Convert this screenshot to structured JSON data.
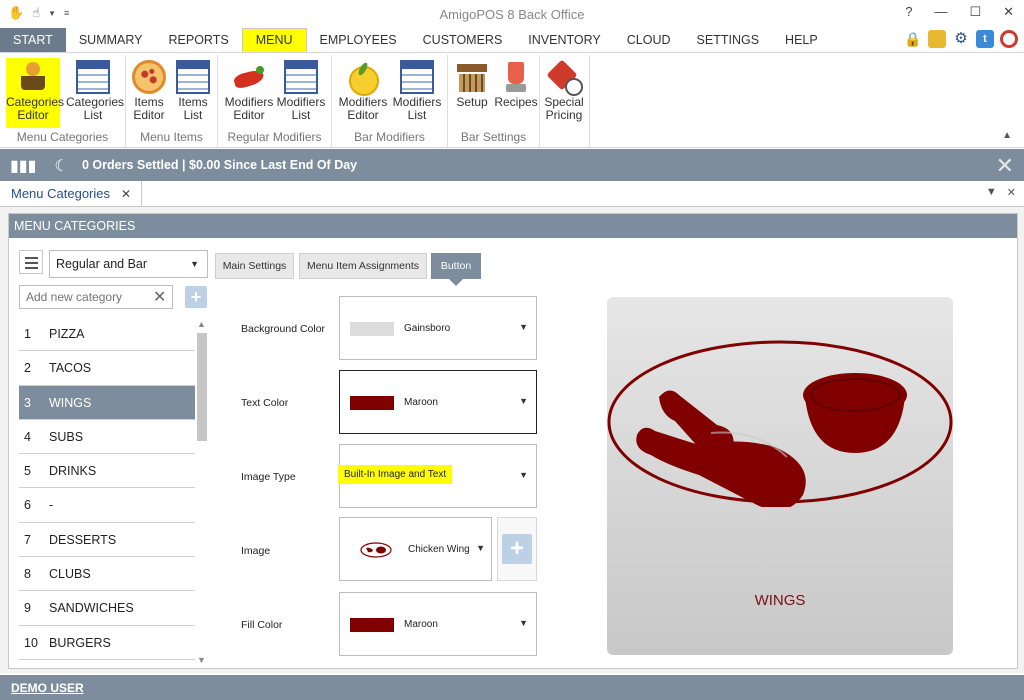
{
  "window": {
    "title": "AmigoPOS 8 Back Office",
    "help": "?"
  },
  "menu_tabs": [
    "START",
    "SUMMARY",
    "REPORTS",
    "MENU",
    "EMPLOYEES",
    "CUSTOMERS",
    "INVENTORY",
    "CLOUD",
    "SETTINGS",
    "HELP"
  ],
  "active_tab": "MENU",
  "ribbon": {
    "groups": [
      {
        "label": "Menu Categories",
        "buttons": [
          {
            "line1": "Categories",
            "line2": "Editor",
            "icon": "categories-editor-icon"
          },
          {
            "line1": "Categories",
            "line2": "List",
            "icon": "table-icon"
          }
        ]
      },
      {
        "label": "Menu Items",
        "buttons": [
          {
            "line1": "Items",
            "line2": "Editor",
            "icon": "pizza-icon"
          },
          {
            "line1": "Items",
            "line2": "List",
            "icon": "table-icon"
          }
        ]
      },
      {
        "label": "Regular Modifiers",
        "buttons": [
          {
            "line1": "Modifiers",
            "line2": "Editor",
            "icon": "pepper-icon"
          },
          {
            "line1": "Modifiers",
            "line2": "List",
            "icon": "table-icon"
          }
        ]
      },
      {
        "label": "Bar Modifiers",
        "buttons": [
          {
            "line1": "Modifiers",
            "line2": "Editor",
            "icon": "lemon-icon"
          },
          {
            "line1": "Modifiers",
            "line2": "List",
            "icon": "table-icon"
          }
        ]
      },
      {
        "label": "Bar Settings",
        "buttons": [
          {
            "line1": "Setup",
            "line2": "",
            "icon": "bar-icon"
          },
          {
            "line1": "Recipes",
            "line2": "",
            "icon": "blender-icon"
          }
        ]
      },
      {
        "label": "",
        "buttons": [
          {
            "line1": "Special",
            "line2": "Pricing",
            "icon": "price-tag-icon"
          }
        ]
      }
    ]
  },
  "status": {
    "text": "0 Orders Settled | $0.00 Since Last End Of Day"
  },
  "doc_tab": {
    "label": "Menu Categories"
  },
  "panel": {
    "title": "MENU CATEGORIES",
    "category_type": "Regular and Bar",
    "add_placeholder": "Add new category",
    "categories": [
      {
        "num": "1",
        "name": "PIZZA"
      },
      {
        "num": "2",
        "name": "TACOS"
      },
      {
        "num": "3",
        "name": "WINGS"
      },
      {
        "num": "4",
        "name": "SUBS"
      },
      {
        "num": "5",
        "name": "DRINKS"
      },
      {
        "num": "6",
        "name": "-"
      },
      {
        "num": "7",
        "name": "DESSERTS"
      },
      {
        "num": "8",
        "name": "CLUBS"
      },
      {
        "num": "9",
        "name": "SANDWICHES"
      },
      {
        "num": "10",
        "name": "BURGERS"
      }
    ],
    "selected_index": 2,
    "settings_tabs": [
      "Main Settings",
      "Menu Item Assignments",
      "Button"
    ],
    "active_settings_tab": "Button",
    "fields": {
      "background_color": {
        "label": "Background Color",
        "value": "Gainsboro",
        "swatch": "#dcdcdc"
      },
      "text_color": {
        "label": "Text Color",
        "value": "Maroon",
        "swatch": "#800000"
      },
      "image_type": {
        "label": "Image Type",
        "value": "Built-In Image and Text"
      },
      "image": {
        "label": "Image",
        "value": "Chicken Wing"
      },
      "fill_color": {
        "label": "Fill Color",
        "value": "Maroon",
        "swatch": "#800000"
      }
    },
    "preview_text": "WINGS"
  },
  "user": {
    "name": "DEMO USER"
  },
  "colors": {
    "accent": "#7d8d9e",
    "highlight": "#ffff00",
    "maroon": "#800000"
  }
}
